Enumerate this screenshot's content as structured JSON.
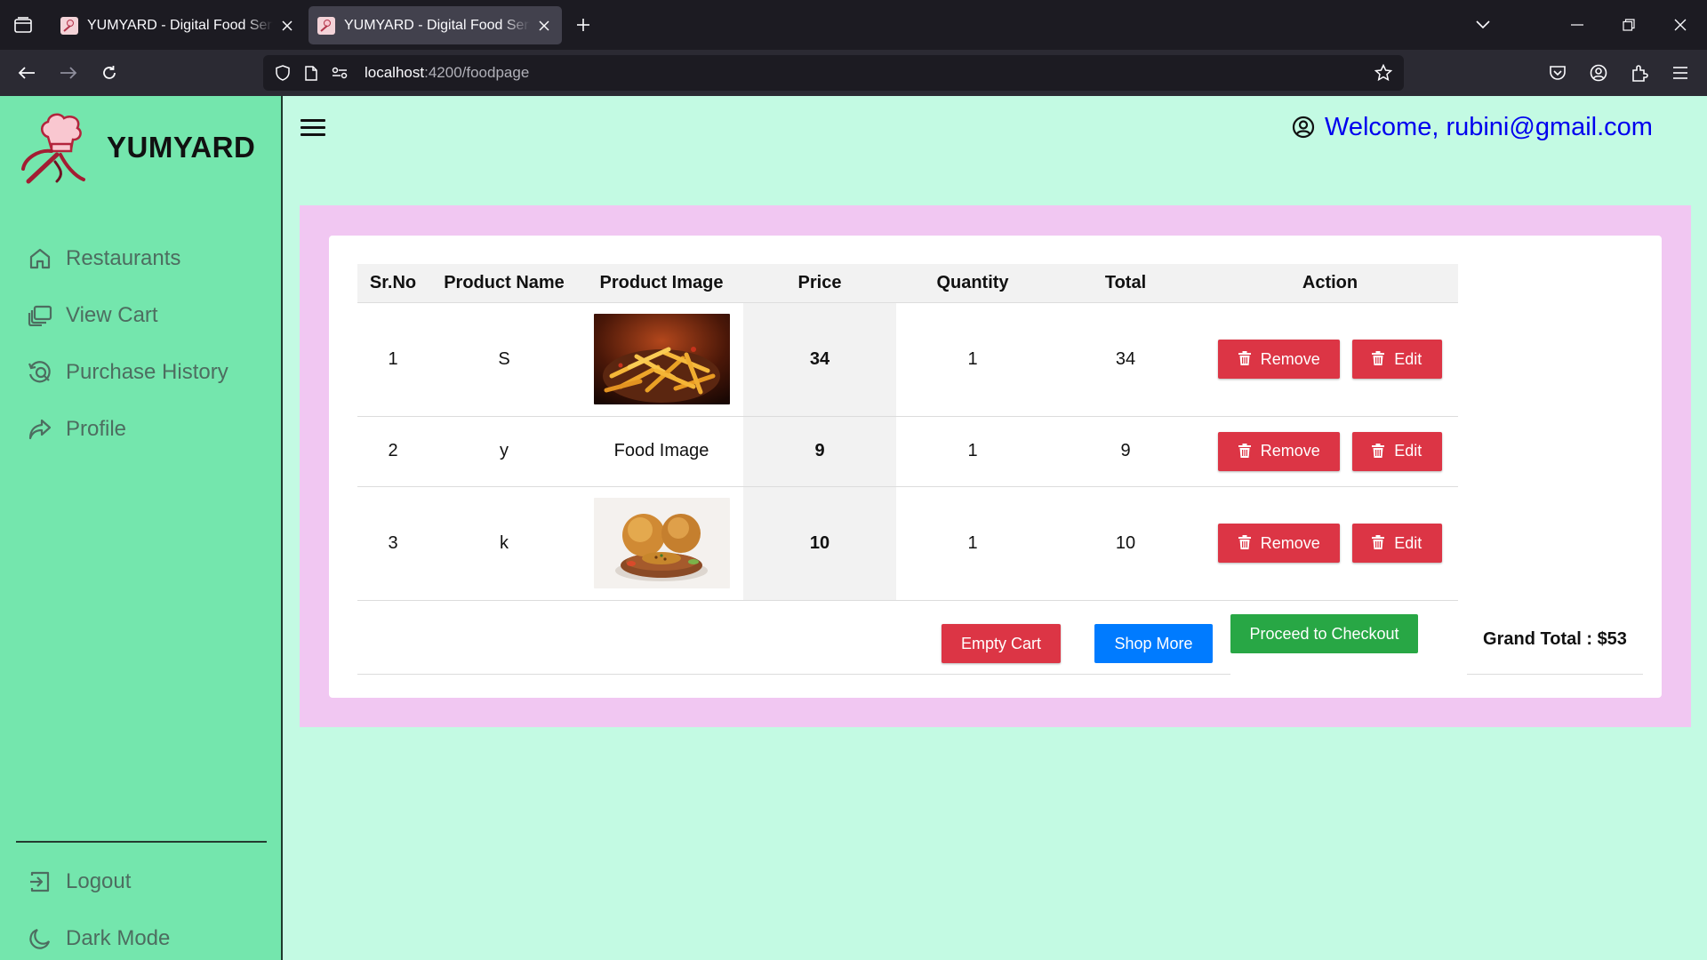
{
  "browser": {
    "tabs": [
      {
        "title": "YUMYARD - Digital Food Service",
        "active": false
      },
      {
        "title": "YUMYARD - Digital Food Service",
        "active": true
      }
    ],
    "url_host": "localhost",
    "url_path": ":4200/foodpage"
  },
  "sidebar": {
    "logo_text": "YUMYARD",
    "items": [
      {
        "label": "Restaurants",
        "icon": "home-icon"
      },
      {
        "label": "View Cart",
        "icon": "cart-stack-icon"
      },
      {
        "label": "Purchase History",
        "icon": "history-search-icon"
      },
      {
        "label": "Profile",
        "icon": "share-arrow-icon"
      }
    ],
    "bottom_items": [
      {
        "label": "Logout",
        "icon": "logout-icon"
      },
      {
        "label": "Dark Mode",
        "icon": "moon-icon"
      }
    ]
  },
  "header": {
    "welcome": "Welcome, rubini@gmail.com"
  },
  "cart": {
    "columns": [
      "Sr.No",
      "Product Name",
      "Product Image",
      "Price",
      "Quantity",
      "Total",
      "Action"
    ],
    "rows": [
      {
        "srno": "1",
        "name": "S",
        "image": "fries-image",
        "image_alt": "",
        "price": "34",
        "quantity": "1",
        "total": "34"
      },
      {
        "srno": "2",
        "name": "y",
        "image": "",
        "image_alt": "Food Image",
        "price": "9",
        "quantity": "1",
        "total": "9"
      },
      {
        "srno": "3",
        "name": "k",
        "image": "poori-image",
        "image_alt": "",
        "price": "10",
        "quantity": "1",
        "total": "10"
      }
    ],
    "remove_label": "Remove",
    "edit_label": "Edit",
    "empty_cart_label": "Empty Cart",
    "shop_more_label": "Shop More",
    "checkout_label": "Proceed to Checkout",
    "grand_total": "Grand Total : $53"
  },
  "colors": {
    "sidebar_bg": "#74e6ad",
    "page_bg": "#c3fae3",
    "panel_bg": "#f1c7f2",
    "danger": "#dc3545",
    "primary": "#007bff",
    "success": "#28a745",
    "link": "#0000ee"
  }
}
